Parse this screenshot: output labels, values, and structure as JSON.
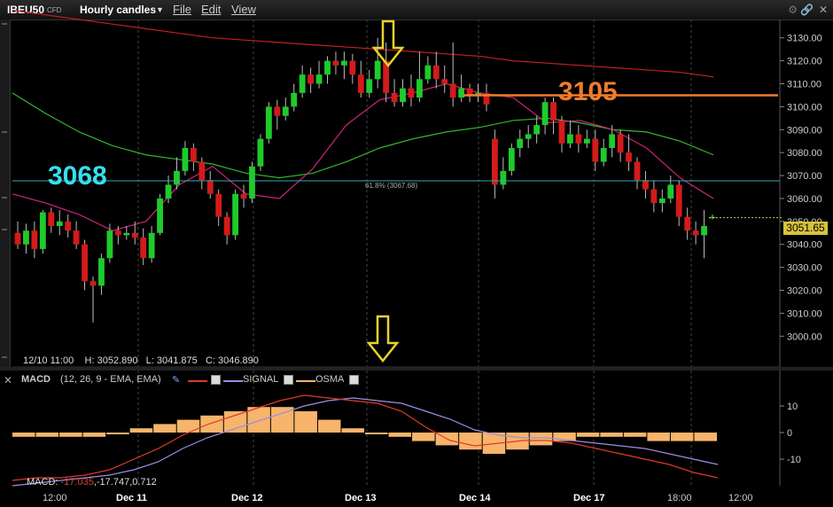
{
  "toolbar": {
    "symbol": "IBEU50",
    "symbol_type": "CFD",
    "period": "Hourly candles",
    "menu_file": "File",
    "menu_edit": "Edit",
    "menu_view": "View",
    "icons": [
      "gear-icon",
      "link-icon",
      "close-icon"
    ]
  },
  "crosshair_info": {
    "date": "12/10 11:00",
    "high": "H: 3052.890",
    "low": "L: 3041.875",
    "close": "C: 3046.890"
  },
  "macd_panel": {
    "title": "MACD",
    "params": "(12, 26, 9 - EMA, EMA)",
    "signal_label": "SIGNAL",
    "osma_label": "OSMA",
    "value_prefix": "MACD:",
    "values": "-17.035",
    "values_rest": ",-17.747,0.712"
  },
  "time_axis": [
    "12:00",
    "Dec 11",
    "Dec 12",
    "Dec 13",
    "Dec 14",
    "Dec 17",
    "18:00",
    "12:00"
  ],
  "annotations": {
    "level_low": "3068",
    "level_high": "3105",
    "fib_label": "61.8% (3067.68)",
    "last_price": "3051.65"
  },
  "colors": {
    "up": "#1ecb2a",
    "down": "#d41a1a",
    "ma_long": "#c0201e",
    "ma_mid": "#33b533",
    "ma_short": "#c8247a",
    "macd": "#e03a2a",
    "signal": "#9c8ee0",
    "osma": "#f7b46a",
    "cyan": "#37e0f0",
    "orange": "#f07c2c",
    "arrow": "#e8d428"
  },
  "chart_data": [
    {
      "type": "candlestick",
      "title": "IBEU50 CFD Hourly candles",
      "y_axis_ticks": [
        3000,
        3010,
        3020,
        3030,
        3040,
        3050,
        3060,
        3070,
        3080,
        3090,
        3100,
        3110,
        3120,
        3130
      ],
      "ylim": [
        2992,
        3138
      ],
      "x_axis_ticks": [
        "12:00",
        "Dec 11",
        "Dec 12",
        "Dec 13",
        "Dec 14",
        "Dec 17",
        "18:00",
        "12:00"
      ],
      "candles": [
        [
          3045,
          3040,
          3050,
          3038
        ],
        [
          3040,
          3046,
          3049,
          3036
        ],
        [
          3046,
          3038,
          3050,
          3034
        ],
        [
          3038,
          3054,
          3055,
          3036
        ],
        [
          3054,
          3048,
          3056,
          3045
        ],
        [
          3048,
          3050,
          3055,
          3044
        ],
        [
          3050,
          3046,
          3053,
          3043
        ],
        [
          3046,
          3040,
          3050,
          3038
        ],
        [
          3040,
          3024,
          3042,
          3020
        ],
        [
          3024,
          3022,
          3026,
          3006
        ],
        [
          3022,
          3034,
          3036,
          3018
        ],
        [
          3034,
          3046,
          3049,
          3032
        ],
        [
          3046,
          3044,
          3048,
          3040
        ],
        [
          3044,
          3045,
          3048,
          3042
        ],
        [
          3045,
          3043,
          3050,
          3040
        ],
        [
          3043,
          3034,
          3047,
          3031
        ],
        [
          3034,
          3045,
          3048,
          3032
        ],
        [
          3045,
          3060,
          3062,
          3044
        ],
        [
          3060,
          3066,
          3070,
          3058
        ],
        [
          3066,
          3072,
          3078,
          3064
        ],
        [
          3072,
          3082,
          3085,
          3070
        ],
        [
          3082,
          3076,
          3084,
          3072
        ],
        [
          3076,
          3068,
          3078,
          3064
        ],
        [
          3068,
          3062,
          3072,
          3060
        ],
        [
          3062,
          3052,
          3064,
          3048
        ],
        [
          3052,
          3044,
          3054,
          3040
        ],
        [
          3044,
          3062,
          3064,
          3042
        ],
        [
          3062,
          3060,
          3066,
          3056
        ],
        [
          3060,
          3074,
          3076,
          3058
        ],
        [
          3074,
          3086,
          3088,
          3072
        ],
        [
          3086,
          3100,
          3102,
          3084
        ],
        [
          3100,
          3096,
          3103,
          3090
        ],
        [
          3096,
          3100,
          3104,
          3094
        ],
        [
          3100,
          3106,
          3110,
          3098
        ],
        [
          3106,
          3114,
          3118,
          3104
        ],
        [
          3114,
          3110,
          3117,
          3106
        ],
        [
          3110,
          3114,
          3120,
          3108
        ],
        [
          3114,
          3120,
          3122,
          3110
        ],
        [
          3120,
          3118,
          3124,
          3114
        ],
        [
          3118,
          3120,
          3124,
          3112
        ],
        [
          3120,
          3114,
          3123,
          3110
        ],
        [
          3114,
          3106,
          3120,
          3104
        ],
        [
          3106,
          3112,
          3116,
          3104
        ],
        [
          3112,
          3120,
          3130,
          3108
        ],
        [
          3120,
          3106,
          3128,
          3102
        ],
        [
          3106,
          3102,
          3112,
          3100
        ],
        [
          3102,
          3108,
          3112,
          3100
        ],
        [
          3108,
          3104,
          3114,
          3100
        ],
        [
          3104,
          3112,
          3124,
          3102
        ],
        [
          3112,
          3118,
          3122,
          3110
        ],
        [
          3118,
          3112,
          3124,
          3108
        ],
        [
          3112,
          3110,
          3118,
          3106
        ],
        [
          3110,
          3104,
          3128,
          3100
        ],
        [
          3104,
          3108,
          3114,
          3102
        ],
        [
          3108,
          3105,
          3110,
          3102
        ],
        [
          3105,
          3106,
          3110,
          3102
        ],
        [
          3106,
          3101,
          3110,
          3098
        ],
        [
          3086,
          3066,
          3090,
          3060
        ],
        [
          3066,
          3072,
          3078,
          3064
        ],
        [
          3072,
          3082,
          3084,
          3070
        ],
        [
          3082,
          3086,
          3090,
          3078
        ],
        [
          3086,
          3088,
          3092,
          3082
        ],
        [
          3088,
          3092,
          3096,
          3084
        ],
        [
          3092,
          3102,
          3104,
          3088
        ],
        [
          3102,
          3094,
          3104,
          3088
        ],
        [
          3094,
          3084,
          3096,
          3080
        ],
        [
          3084,
          3088,
          3094,
          3082
        ],
        [
          3088,
          3084,
          3092,
          3080
        ],
        [
          3084,
          3086,
          3090,
          3082
        ],
        [
          3086,
          3076,
          3090,
          3072
        ],
        [
          3076,
          3082,
          3086,
          3074
        ],
        [
          3082,
          3088,
          3092,
          3078
        ],
        [
          3088,
          3080,
          3090,
          3076
        ],
        [
          3080,
          3076,
          3088,
          3072
        ],
        [
          3076,
          3068,
          3078,
          3064
        ],
        [
          3068,
          3064,
          3072,
          3060
        ],
        [
          3064,
          3058,
          3068,
          3054
        ],
        [
          3058,
          3060,
          3064,
          3054
        ],
        [
          3060,
          3066,
          3070,
          3058
        ],
        [
          3066,
          3052,
          3068,
          3048
        ],
        [
          3052,
          3046,
          3056,
          3042
        ],
        [
          3046,
          3044,
          3050,
          3040
        ],
        [
          3044,
          3048,
          3055,
          3034
        ],
        [
          3052,
          3052,
          3053,
          3051
        ]
      ],
      "ma_long": [
        3142,
        3140,
        3138,
        3136,
        3134,
        3132,
        3130,
        3129,
        3128,
        3127,
        3126,
        3125,
        3124,
        3123,
        3122,
        3120,
        3119,
        3118,
        3117,
        3116,
        3115,
        3113
      ],
      "ma_mid": [
        3106,
        3097,
        3089,
        3083,
        3079,
        3077,
        3075,
        3071,
        3069,
        3071,
        3076,
        3082,
        3086,
        3089,
        3091,
        3094,
        3095,
        3093,
        3090,
        3089,
        3085,
        3079
      ],
      "ma_short": [
        3062,
        3058,
        3053,
        3046,
        3050,
        3066,
        3074,
        3062,
        3060,
        3073,
        3092,
        3103,
        3106,
        3110,
        3106,
        3104,
        3093,
        3094,
        3090,
        3082,
        3069,
        3060
      ],
      "horizontal_lines": [
        {
          "label": "3068",
          "value": 3067.68,
          "note": "61.8% (3067.68)"
        },
        {
          "label": "3105",
          "value": 3105
        }
      ],
      "last_price": 3051.65
    },
    {
      "type": "macd",
      "title": "MACD",
      "params": "(12, 26, 9 - EMA, EMA)",
      "y_axis_ticks": [
        10,
        0,
        -10
      ],
      "ylim": [
        -20,
        16
      ],
      "macd_line": [
        -18,
        -17,
        -17,
        -16,
        -14,
        -10,
        -6,
        -1,
        3,
        6,
        9,
        12,
        14,
        13,
        12,
        11,
        8,
        2,
        -3,
        -5,
        -4,
        -3,
        -3,
        -4,
        -6,
        -8,
        -10,
        -12,
        -15,
        -17
      ],
      "signal_line": [
        -20,
        -19,
        -18,
        -17,
        -16,
        -14,
        -11,
        -6,
        -2,
        1,
        4,
        7,
        10,
        12,
        13,
        12,
        11,
        8,
        5,
        1,
        -1,
        -2,
        -2,
        -3,
        -4,
        -5,
        -6,
        -8,
        -10,
        -12
      ],
      "osma": [
        -1,
        -1,
        -1,
        -1,
        0,
        1,
        2,
        3,
        4,
        5,
        6,
        6,
        5,
        3,
        1,
        0,
        -1,
        -2,
        -3,
        -4,
        -5,
        -4,
        -3,
        -2,
        -1,
        -1,
        -1,
        -2,
        -2,
        -2
      ]
    }
  ]
}
